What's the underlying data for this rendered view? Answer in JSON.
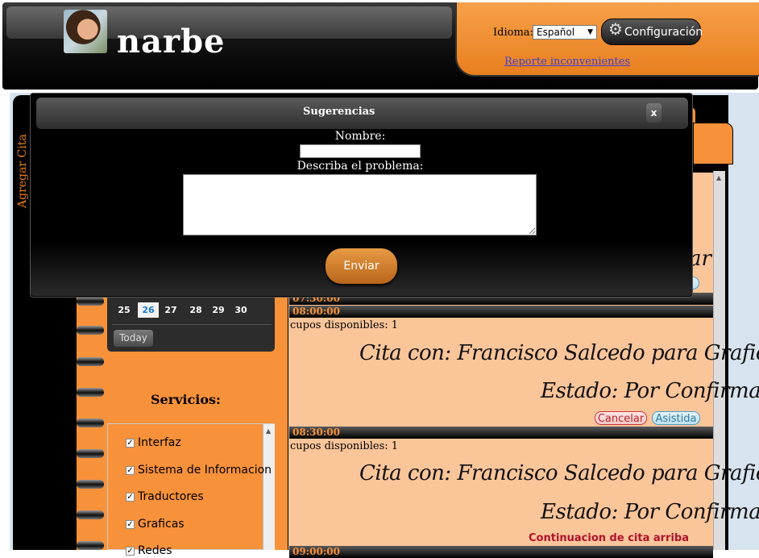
{
  "header": {
    "site_title": "narbe",
    "language_label": "Idioma:",
    "language_selected": "Español",
    "config_label": "Configuración",
    "report_link": "Reporte inconvenientes"
  },
  "sidebar": {
    "vertical_label": "Agregar Cita"
  },
  "calendar": {
    "days_row": [
      "25",
      "26",
      "27",
      "28",
      "29",
      "30"
    ],
    "today_day": "26",
    "today_button": "Today"
  },
  "services": {
    "title": "Servicios:",
    "items": [
      {
        "label": "Interfaz",
        "checked": true
      },
      {
        "label": "Sistema de Informacion",
        "checked": true
      },
      {
        "label": "Traductores",
        "checked": true
      },
      {
        "label": "Graficas",
        "checked": true
      },
      {
        "label": "Redes",
        "checked": true
      }
    ]
  },
  "schedule": {
    "slots": [
      {
        "time": "07:30:00"
      },
      {
        "time": "08:00:00",
        "cupos": "cupos disponibles: 1",
        "cita": "Cita con: Francisco Salcedo para Graficas",
        "estado": "Estado: Por Confirmar"
      },
      {
        "time": "08:30:00",
        "cupos": "cupos disponibles: 1",
        "cita": "Cita con: Francisco Salcedo para Graficas",
        "estado": "Estado: Por Confirmar"
      },
      {
        "time": "09:00:00"
      }
    ],
    "cancel_label": "Cancelar",
    "assist_label": "Asistida",
    "continuation_note": "Continuacion de cita arriba",
    "partial_text": "ar"
  },
  "modal": {
    "title": "Sugerencias",
    "close_label": "x",
    "name_label": "Nombre:",
    "name_value": "",
    "problem_label": "Describa el problema:",
    "problem_value": "",
    "send_label": "Enviar"
  }
}
